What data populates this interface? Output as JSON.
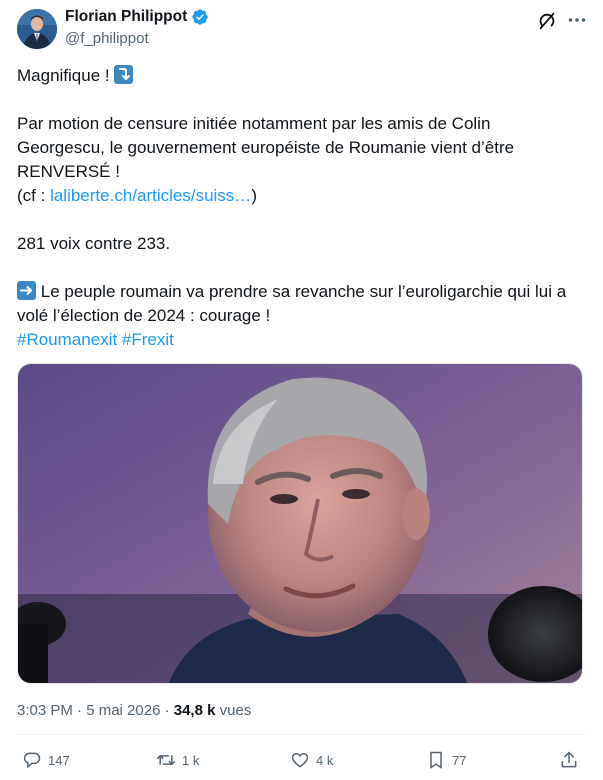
{
  "author": {
    "name": "Florian Philippot",
    "handle": "@f_philippot"
  },
  "tweet": {
    "line1": "Magnifique !",
    "para1_a": "Par motion de censure initiée notamment par les amis de Colin",
    "para1_b": "Georgescu, le gouvernement européiste de Roumanie vient d’être",
    "para1_c": "RENVERSÉ !",
    "cf_prefix": "(cf : ",
    "cf_link": "laliberte.ch/articles/suiss…",
    "cf_suffix": ")",
    "votes": "281 voix contre 233.",
    "para2_a": "Le peuple roumain va prendre sa revanche sur l’euroligarchie qui lui a",
    "para2_b": "volé l’élection de 2024 : courage !",
    "hashtag1": "#Roumanexit",
    "hashtag2": "#Frexit"
  },
  "meta": {
    "time": "3:03 PM · 5 mai 2026 · ",
    "views_count": "34,8 k",
    "views_label": " vues"
  },
  "actions": {
    "replies": "147",
    "reposts": "1 k",
    "likes": "4 k",
    "bookmarks": "77"
  },
  "icons": [
    "verified-icon",
    "grok-icon",
    "more-icon",
    "arrow-down-emoji",
    "arrow-right-emoji",
    "reply-icon",
    "repost-icon",
    "like-icon",
    "bookmark-icon",
    "share-icon"
  ],
  "colors": {
    "link": "#1d9bf0",
    "verified": "#1d9bf0",
    "muted": "#536471",
    "emoji_box": "#3b88c3"
  }
}
